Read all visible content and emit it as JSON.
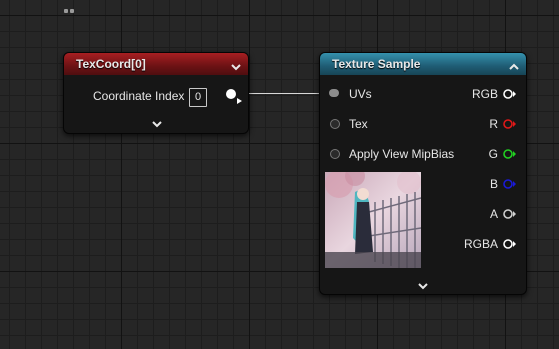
{
  "nodes": {
    "texcoord": {
      "title": "TexCoord[0]",
      "color": "#8a1a1c",
      "input_label": "Coordinate Index",
      "input_value": "0"
    },
    "texture_sample": {
      "title": "Texture Sample",
      "color": "#2a7792",
      "inputs": [
        {
          "label": "UVs",
          "connected": true
        },
        {
          "label": "Tex",
          "connected": false
        },
        {
          "label": "Apply View MipBias",
          "connected": false
        }
      ],
      "outputs": [
        {
          "label": "RGB",
          "color": "#ffffff"
        },
        {
          "label": "R",
          "color": "#e01818"
        },
        {
          "label": "G",
          "color": "#22d022"
        },
        {
          "label": "B",
          "color": "#1a1ad8"
        },
        {
          "label": "A",
          "color": "#cfcfcf"
        },
        {
          "label": "RGBA",
          "color": "#ffffff"
        }
      ]
    }
  },
  "icons": {
    "expand": "chevron-down-icon",
    "collapse": "chevron-up-icon",
    "pin": "arrow-pin-icon"
  }
}
